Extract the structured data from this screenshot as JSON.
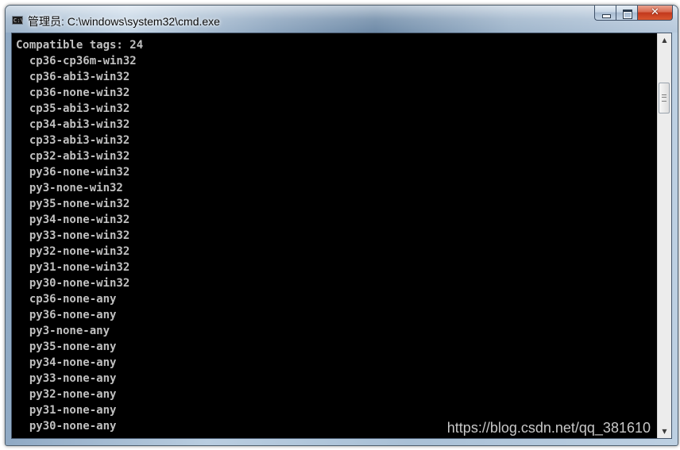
{
  "window": {
    "title": "管理员: C:\\windows\\system32\\cmd.exe",
    "icon": "cmd-console-icon",
    "icon_text": "C:\\",
    "buttons": {
      "minimize_icon": "minimize-icon",
      "maximize_icon": "maximize-icon",
      "close_icon": "close-icon",
      "close_glyph": "✕"
    }
  },
  "colors": {
    "console_background": "#000000",
    "console_text": "#c0c0c0",
    "close_button": "#c8442a"
  },
  "console": {
    "lines": [
      "Compatible tags: 24",
      "  cp36-cp36m-win32",
      "  cp36-abi3-win32",
      "  cp36-none-win32",
      "  cp35-abi3-win32",
      "  cp34-abi3-win32",
      "  cp33-abi3-win32",
      "  cp32-abi3-win32",
      "  py36-none-win32",
      "  py3-none-win32",
      "  py35-none-win32",
      "  py34-none-win32",
      "  py33-none-win32",
      "  py32-none-win32",
      "  py31-none-win32",
      "  py30-none-win32",
      "  cp36-none-any",
      "  py36-none-any",
      "  py3-none-any",
      "  py35-none-any",
      "  py34-none-any",
      "  py33-none-any",
      "  py32-none-any",
      "  py31-none-any",
      "  py30-none-any"
    ]
  },
  "scrollbar": {
    "up_glyph": "▲",
    "down_glyph": "▼"
  },
  "watermark": "https://blog.csdn.net/qq_381610"
}
